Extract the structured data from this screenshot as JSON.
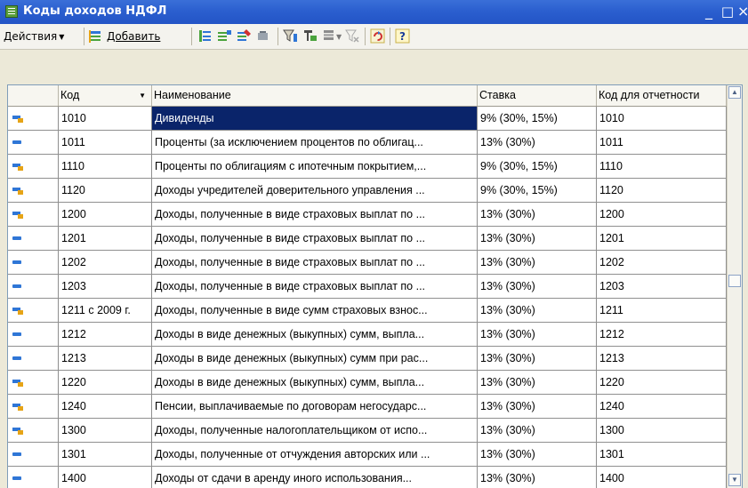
{
  "window": {
    "title": "Коды доходов НДФЛ",
    "buttons": {
      "minimize": "_",
      "maximize": "□",
      "close": "×"
    }
  },
  "toolbar": {
    "actions_label": "Действия",
    "add_label": "Добавить",
    "icons": [
      "add-icon",
      "add-group-icon",
      "copy-icon",
      "edit-icon",
      "delete-icon",
      "filter-icon",
      "tree-icon",
      "list-view-icon",
      "clear-filter-icon",
      "refresh-icon",
      "help-icon"
    ]
  },
  "table": {
    "columns": [
      "",
      "Код",
      "Наименование",
      "Ставка",
      "Код для отчетности"
    ],
    "rows": [
      {
        "type": "group",
        "code": "1010",
        "name": "Дивиденды",
        "rate": "9% (30%, 15%)",
        "report_code": "1010",
        "selected": true
      },
      {
        "type": "elem",
        "code": "1011",
        "name": "Проценты (за исключением процентов по облигац...",
        "rate": "13% (30%)",
        "report_code": "1011"
      },
      {
        "type": "group",
        "code": "1110",
        "name": "Проценты по облигациям с ипотечным покрытием,...",
        "rate": "9% (30%, 15%)",
        "report_code": "1110"
      },
      {
        "type": "group",
        "code": "1120",
        "name": "Доходы учредителей доверительного управления ...",
        "rate": "9% (30%, 15%)",
        "report_code": "1120"
      },
      {
        "type": "group",
        "code": "1200",
        "name": "Доходы, полученные в виде страховых выплат по ...",
        "rate": "13% (30%)",
        "report_code": "1200"
      },
      {
        "type": "elem",
        "code": "1201",
        "name": "Доходы, полученные в виде страховых выплат по ...",
        "rate": "13% (30%)",
        "report_code": "1201"
      },
      {
        "type": "elem",
        "code": "1202",
        "name": "Доходы, полученные в виде страховых выплат по ...",
        "rate": "13% (30%)",
        "report_code": "1202"
      },
      {
        "type": "elem",
        "code": "1203",
        "name": "Доходы, полученные в виде страховых выплат по ...",
        "rate": "13% (30%)",
        "report_code": "1203"
      },
      {
        "type": "group",
        "code": "1211 с 2009 г.",
        "name": "Доходы, полученные в виде сумм страховых взнос...",
        "rate": "13% (30%)",
        "report_code": "1211"
      },
      {
        "type": "elem",
        "code": "1212",
        "name": "Доходы в виде денежных (выкупных) сумм, выпла...",
        "rate": "13% (30%)",
        "report_code": "1212"
      },
      {
        "type": "elem",
        "code": "1213",
        "name": "Доходы в виде денежных (выкупных) сумм при рас...",
        "rate": "13% (30%)",
        "report_code": "1213"
      },
      {
        "type": "group",
        "code": "1220",
        "name": "Доходы в виде денежных (выкупных) сумм, выпла...",
        "rate": "13% (30%)",
        "report_code": "1220"
      },
      {
        "type": "group",
        "code": "1240",
        "name": "Пенсии, выплачиваемые по договорам негосударс...",
        "rate": "13% (30%)",
        "report_code": "1240"
      },
      {
        "type": "group",
        "code": "1300",
        "name": "Доходы, полученные налогоплательщиком от испо...",
        "rate": "13% (30%)",
        "report_code": "1300"
      },
      {
        "type": "elem",
        "code": "1301",
        "name": "Доходы, полученные от отчуждения авторских или ...",
        "rate": "13% (30%)",
        "report_code": "1301"
      },
      {
        "type": "elem",
        "code": "1400",
        "name": "Доходы от сдачи в аренду иного использования...",
        "rate": "13% (30%)",
        "report_code": "1400"
      }
    ]
  }
}
